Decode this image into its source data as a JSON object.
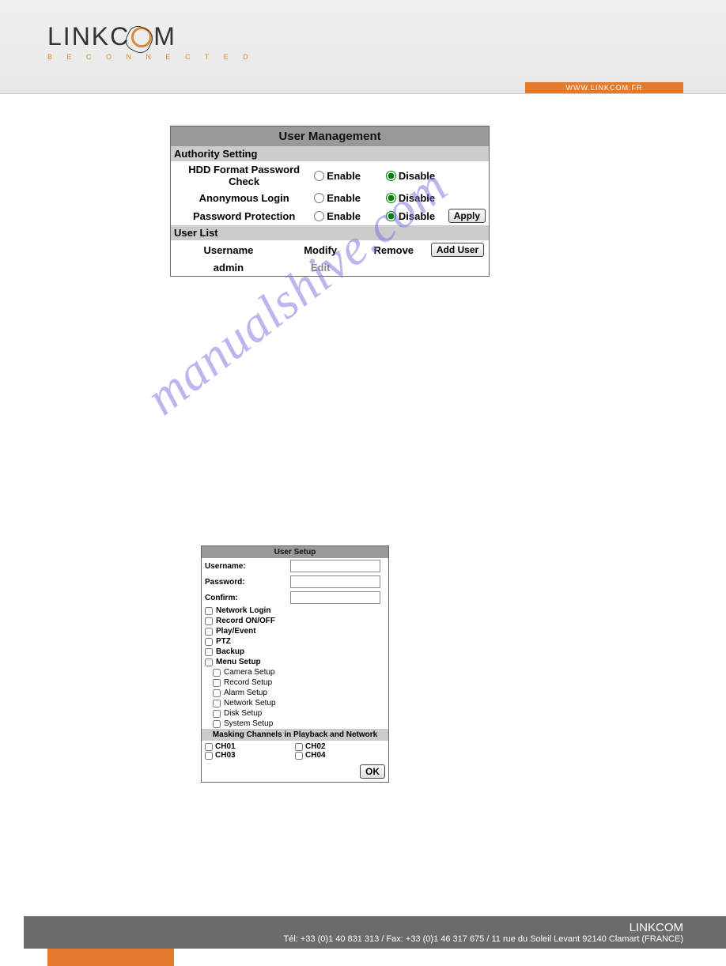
{
  "header": {
    "brand_pre": "LINKC",
    "brand_post": "M",
    "tagline": "B E   C O N N E C T E D",
    "url": "WWW.LINKCOM.FR"
  },
  "panel1": {
    "title": "User Management",
    "section_auth": "Authority Setting",
    "rows": [
      {
        "label": "HDD Format Password Check",
        "enable": "Enable",
        "disable": "Disable",
        "selected": "disable"
      },
      {
        "label": "Anonymous  Login",
        "enable": "Enable",
        "disable": "Disable",
        "selected": "disable"
      },
      {
        "label": "Password Protection",
        "enable": "Enable",
        "disable": "Disable",
        "selected": "disable"
      }
    ],
    "apply": "Apply",
    "section_users": "User List",
    "user_head": {
      "c1": "Username",
      "c2": "Modify",
      "c3": "Remove",
      "c4": "Add User"
    },
    "users": [
      {
        "name": "admin",
        "edit": "Edit"
      }
    ]
  },
  "panel2": {
    "title": "User Setup",
    "fields": {
      "username": "Username:",
      "password": "Password:",
      "confirm": "Confirm:"
    },
    "perms": [
      {
        "label": "Network Login",
        "sub": false
      },
      {
        "label": "Record ON/OFF",
        "sub": false
      },
      {
        "label": "Play/Event",
        "sub": false
      },
      {
        "label": "PTZ",
        "sub": false
      },
      {
        "label": "Backup",
        "sub": false
      },
      {
        "label": "Menu Setup",
        "sub": false
      },
      {
        "label": "Camera Setup",
        "sub": true
      },
      {
        "label": "Record Setup",
        "sub": true
      },
      {
        "label": "Alarm Setup",
        "sub": true
      },
      {
        "label": "Network Setup",
        "sub": true
      },
      {
        "label": "Disk Setup",
        "sub": true
      },
      {
        "label": "System Setup",
        "sub": true
      }
    ],
    "mask_title": "Masking Channels in Playback and Network",
    "channels": [
      "CH01",
      "CH02",
      "CH03",
      "CH04"
    ],
    "ok": "OK"
  },
  "watermark": "manualshive.com",
  "footer": {
    "company": "LINKCOM",
    "contact": "Tél: +33 (0)1 40 831 313 / Fax: +33 (0)1 46 317 675 / 11 rue du Soleil Levant 92140 Clamart (FRANCE)"
  }
}
